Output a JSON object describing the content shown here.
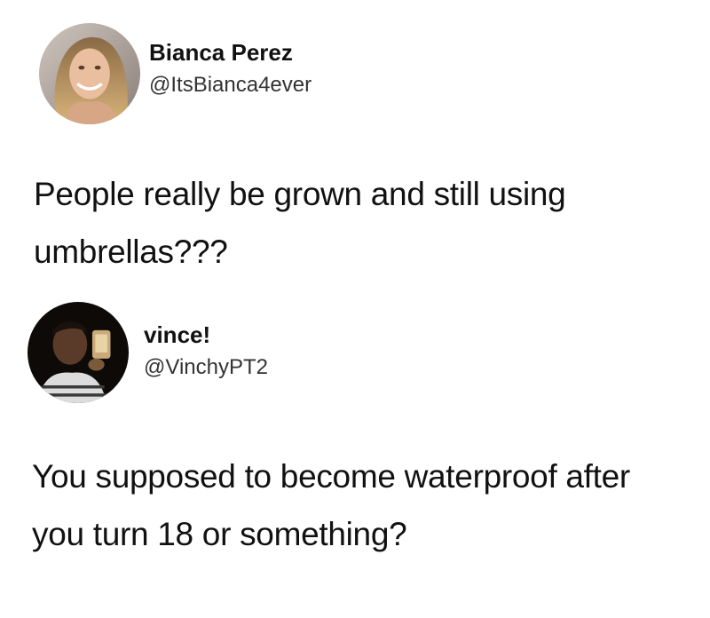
{
  "tweets": [
    {
      "author_name": "Bianca Perez",
      "author_handle": "@ItsBianca4ever",
      "avatar_icon": "profile-photo-blonde-woman",
      "text": "People really be grown and still using umbrellas???"
    },
    {
      "author_name": "vince!",
      "author_handle": "@VinchyPT2",
      "avatar_icon": "profile-photo-mirror-selfie",
      "text": "You supposed to become waterproof after you turn 18 or something?"
    }
  ]
}
